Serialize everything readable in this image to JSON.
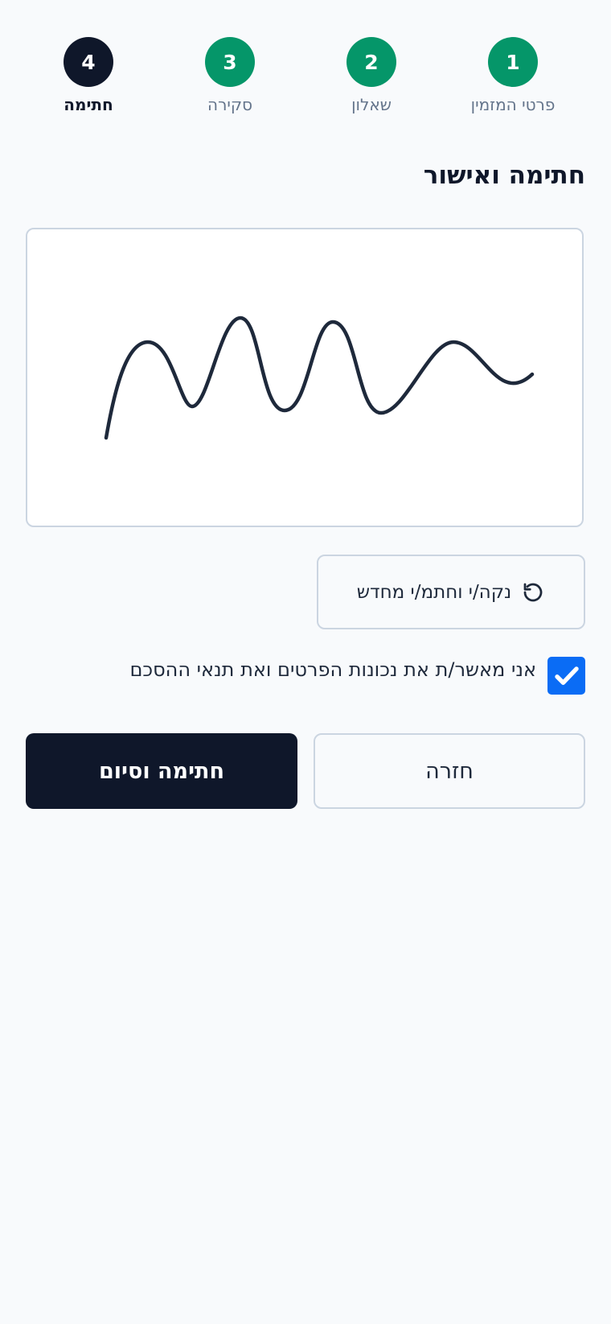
{
  "stepper": {
    "steps": [
      {
        "number": "1",
        "label": "פרטי המזמין",
        "status": "done"
      },
      {
        "number": "2",
        "label": "שאלון",
        "status": "done"
      },
      {
        "number": "3",
        "label": "סקירה",
        "status": "done"
      },
      {
        "number": "4",
        "label": "חתימה",
        "status": "current"
      }
    ]
  },
  "main": {
    "title": "חתימה ואישור"
  },
  "signature": {
    "clear_label": "נקה/י וחתמ/י מחדש",
    "clear_icon": "refresh-icon"
  },
  "consent": {
    "label": "אני מאשר/ת את נכונות הפרטים ואת תנאי ההסכם",
    "checked": true
  },
  "actions": {
    "back_label": "חזרה",
    "finish_label": "חתימה וסיום"
  },
  "colors": {
    "done": "#059669",
    "current": "#0f172a",
    "checkbox": "#0a6cf5",
    "ink": "#1e293b"
  }
}
